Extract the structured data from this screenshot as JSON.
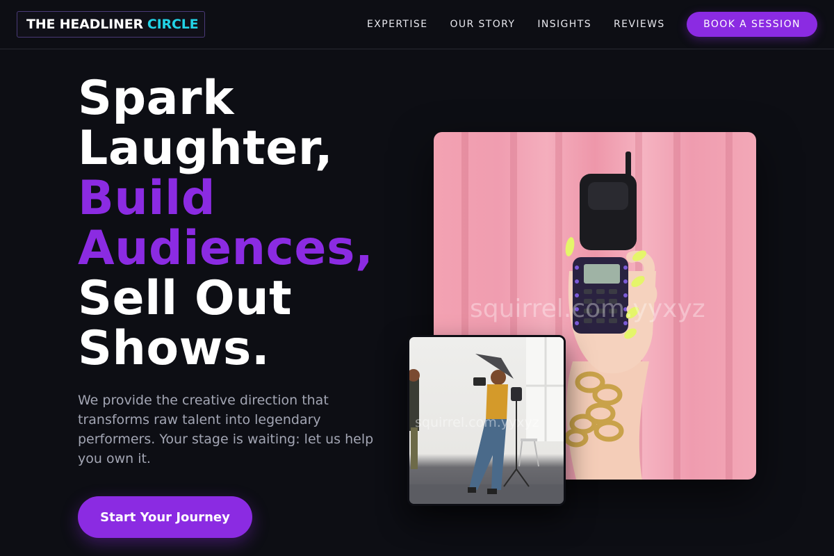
{
  "header": {
    "logo_main": "THE HEADLINER",
    "logo_accent": "CIRCLE",
    "nav": [
      "EXPERTISE",
      "OUR STORY",
      "INSIGHTS",
      "REVIEWS"
    ],
    "book_label": "BOOK A SESSION"
  },
  "hero": {
    "headline_lines": [
      {
        "text": "Spark",
        "accent": false
      },
      {
        "text": "Laughter,",
        "accent": false
      },
      {
        "text": "Build",
        "accent": true
      },
      {
        "text": "Audiences,",
        "accent": true
      },
      {
        "text": "Sell Out",
        "accent": false
      },
      {
        "text": "Shows.",
        "accent": false
      }
    ],
    "description": "We provide the creative direction that transforms raw talent into legendary performers. Your stage is waiting: let us help you own it.",
    "cta_label": "Start Your Journey"
  },
  "images": {
    "main_watermark": "squirrel.com.yyxyz",
    "small_watermark": "squirrel.com.yyxyz"
  },
  "colors": {
    "accent_purple": "#8b2be2",
    "accent_cyan": "#22d3e6",
    "background": "#0d0e14"
  }
}
